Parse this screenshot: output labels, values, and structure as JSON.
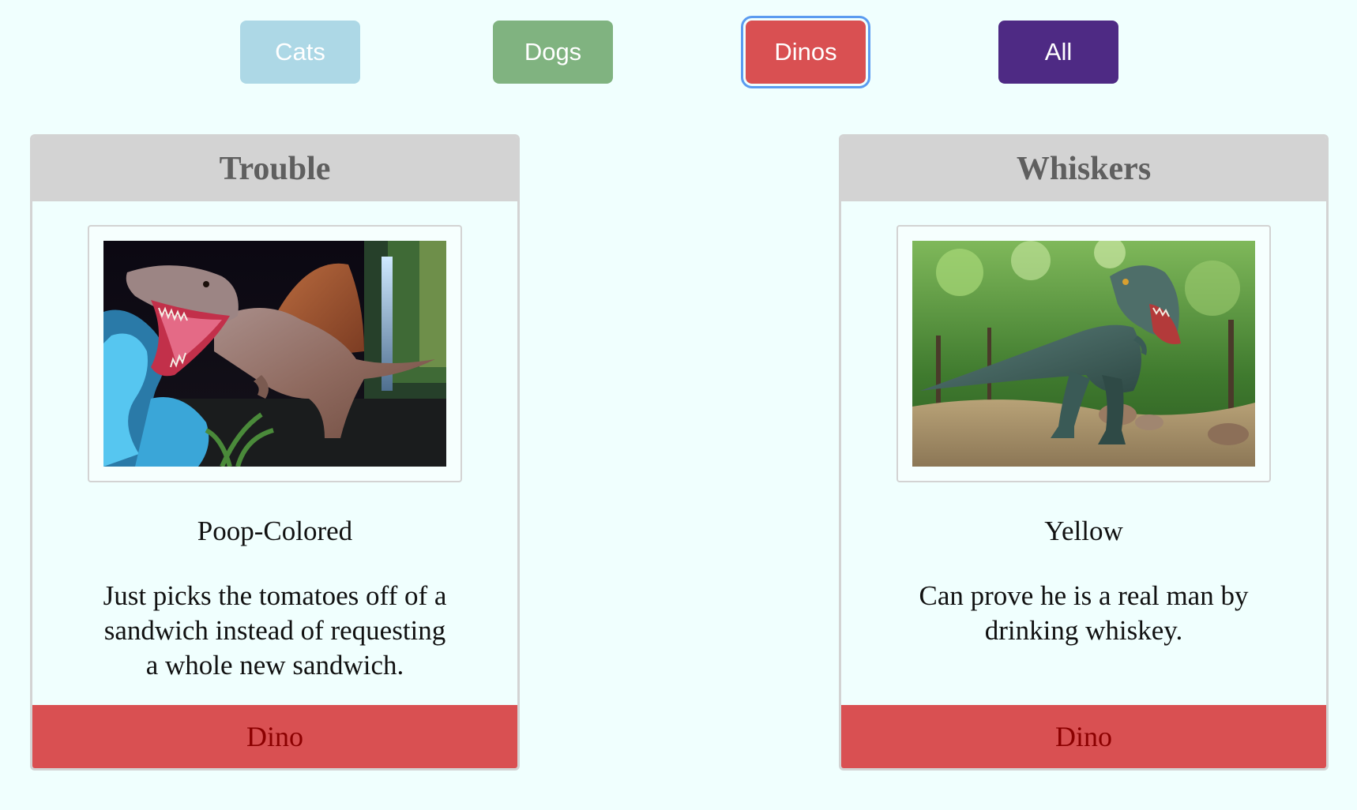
{
  "filters": {
    "cats_label": "Cats",
    "dogs_label": "Dogs",
    "dinos_label": "Dinos",
    "all_label": "All",
    "active": "Dinos"
  },
  "colors": {
    "page_background": "#f0fffe",
    "cats": "#add8e6",
    "dogs": "#80b380",
    "dinos": "#d95052",
    "all": "#4e2a84",
    "focus_ring": "#5b9bf0",
    "card_header": "#d3d3d3",
    "footer_text": "#8b0000"
  },
  "cards": [
    {
      "name": "Trouble",
      "image": "spinosaurus-model-photo",
      "color": "Poop-Colored",
      "description": "Just picks the tomatoes off of a sandwich instead of requesting a whole new sandwich.",
      "type": "Dino"
    },
    {
      "name": "Whiskers",
      "image": "t-rex-model-photo",
      "color": "Yellow",
      "description": "Can prove he is a real man by drinking whiskey.",
      "type": "Dino"
    }
  ]
}
